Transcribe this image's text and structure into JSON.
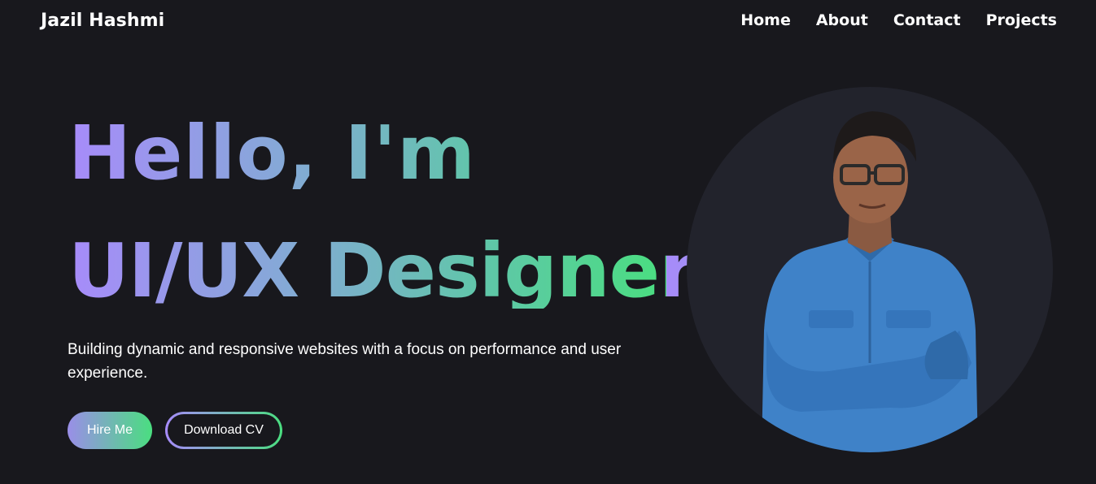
{
  "navbar": {
    "brand": "Jazil Hashmi",
    "links": [
      "Home",
      "About",
      "Contact",
      "Projects"
    ]
  },
  "hero": {
    "greeting": "Hello, I'm",
    "role": "UI/UX Designer",
    "description": "Building dynamic and responsive websites with a focus on performance and user experience.",
    "hire_label": "Hire Me",
    "cv_label": "Download CV"
  },
  "colors": {
    "background": "#18181d",
    "gradient_start": "#a78bfa",
    "gradient_end": "#4ade80",
    "avatar_bg": "#22232c"
  }
}
